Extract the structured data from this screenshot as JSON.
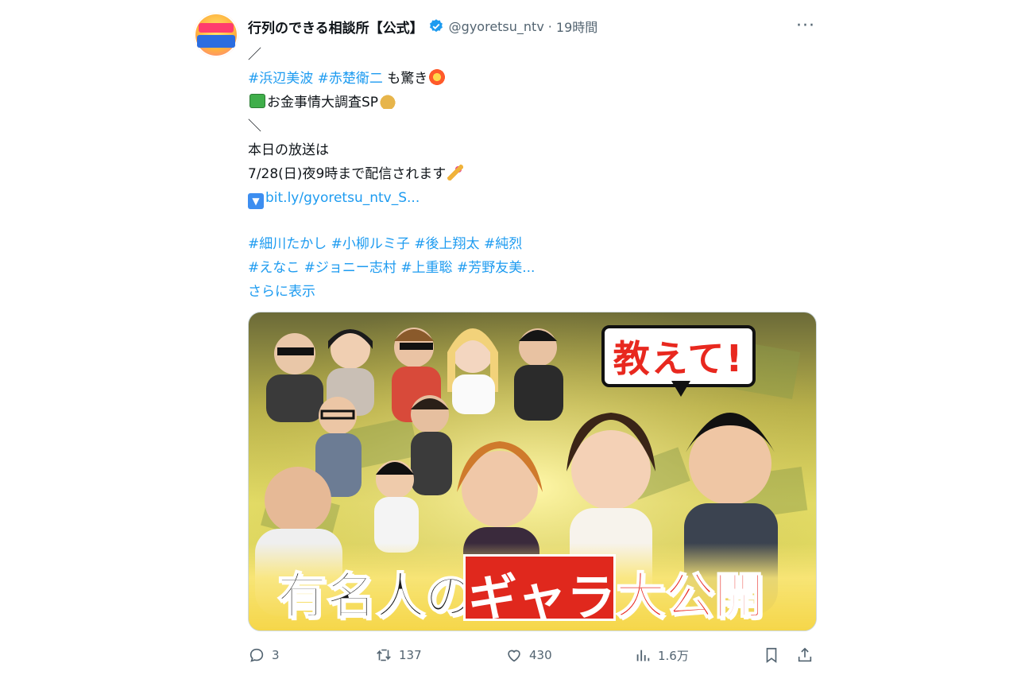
{
  "tweet": {
    "author_name": "行列のできる相談所【公式】",
    "handle": "@gyoretsu_ntv",
    "separator": "·",
    "time": "19時間",
    "more_label": "···",
    "lines": {
      "l1": "／",
      "l2_tag1": "#浜辺美波",
      "l2_tag2": "#赤楚衛二",
      "l2_text": " も驚き",
      "l3_text": "お金事情大調査SP",
      "l4": "＼",
      "l5": "本日の放送は",
      "l6": "7/28(日)夜9時まで配信されます",
      "l7_link": "bit.ly/gyoretsu_ntv_S...",
      "l8_tags": [
        "#細川たかし",
        "#小柳ルミ子",
        "#後上翔太",
        "#純烈"
      ],
      "l9_tags": [
        "#えなこ",
        "#ジョニー志村",
        "#上重聡",
        "#芳野友美..."
      ]
    },
    "show_more": "さらに表示",
    "media": {
      "speech_bubble": "教えて!",
      "banner_part1": "有名人の",
      "banner_part2": "ギャラ",
      "banner_part3": "大公開"
    },
    "stats": {
      "replies": "3",
      "retweets": "137",
      "likes": "430",
      "views": "1.6万"
    }
  },
  "colors": {
    "link": "#1d9bf0",
    "secondary_text": "#536471",
    "verified": "#1d9bf0",
    "banner_red": "#e0281d"
  },
  "icons": [
    "verified-badge-icon",
    "more-icon",
    "reply-icon",
    "retweet-icon",
    "like-icon",
    "views-icon",
    "bookmark-icon",
    "share-icon"
  ]
}
